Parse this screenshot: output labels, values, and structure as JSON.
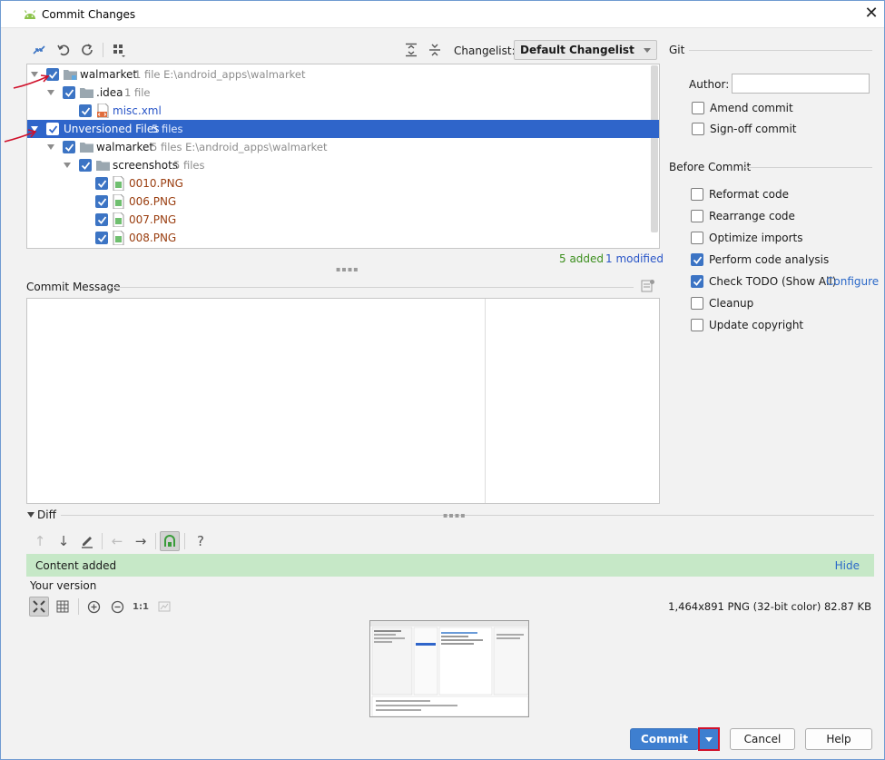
{
  "window": {
    "title": "Commit Changes",
    "close_glyph": "✕"
  },
  "toolbar": {
    "changelist_label": "Changelist:",
    "changelist_value": "Default Changelist"
  },
  "tree": {
    "rows": [
      {
        "label": "walmarket",
        "meta": "1 file  E:\\android_apps\\walmarket"
      },
      {
        "label": ".idea",
        "meta": "1 file"
      },
      {
        "label": "misc.xml",
        "meta": ""
      },
      {
        "label": "Unversioned Files",
        "meta": "5 files"
      },
      {
        "label": "walmarket",
        "meta": "5 files  E:\\android_apps\\walmarket"
      },
      {
        "label": "screenshots",
        "meta": "5 files"
      },
      {
        "label": "0010.PNG",
        "meta": ""
      },
      {
        "label": "006.PNG",
        "meta": ""
      },
      {
        "label": "007.PNG",
        "meta": ""
      },
      {
        "label": "008.PNG",
        "meta": ""
      }
    ],
    "added": "5 added",
    "modified": "1 modified"
  },
  "commit_message": {
    "label": "Commit Message",
    "text": ""
  },
  "git": {
    "title": "Git",
    "author_label": "Author:",
    "author_value": "",
    "amend_commit": "Amend commit",
    "signoff_commit": "Sign-off commit"
  },
  "before_commit": {
    "title": "Before Commit",
    "options": [
      {
        "label": "Reformat code",
        "checked": false
      },
      {
        "label": "Rearrange code",
        "checked": false
      },
      {
        "label": "Optimize imports",
        "checked": false
      },
      {
        "label": "Perform code analysis",
        "checked": true
      },
      {
        "label": "Check TODO (Show All)",
        "checked": true
      },
      {
        "label": "Cleanup",
        "checked": false
      },
      {
        "label": "Update copyright",
        "checked": false
      }
    ],
    "configure_link": "Configure"
  },
  "diff": {
    "title": "Diff",
    "help_glyph": "?",
    "zoom_actual": "1:1",
    "banner_text": "Content added",
    "hide_link": "Hide",
    "your_version": "Your version",
    "image_info": "1,464x891 PNG (32-bit color) 82.87 KB"
  },
  "buttons": {
    "commit": "Commit",
    "cancel": "Cancel",
    "help": "Help"
  },
  "colors": {
    "accent": "#3e7fd0",
    "selection": "#2f65ca",
    "added_green": "#3c8f1e",
    "modified_blue": "#2a56c8",
    "unversioned_brown": "#9a3e10",
    "banner_green": "#c6e8c7",
    "annotation_red": "#d0112b"
  }
}
